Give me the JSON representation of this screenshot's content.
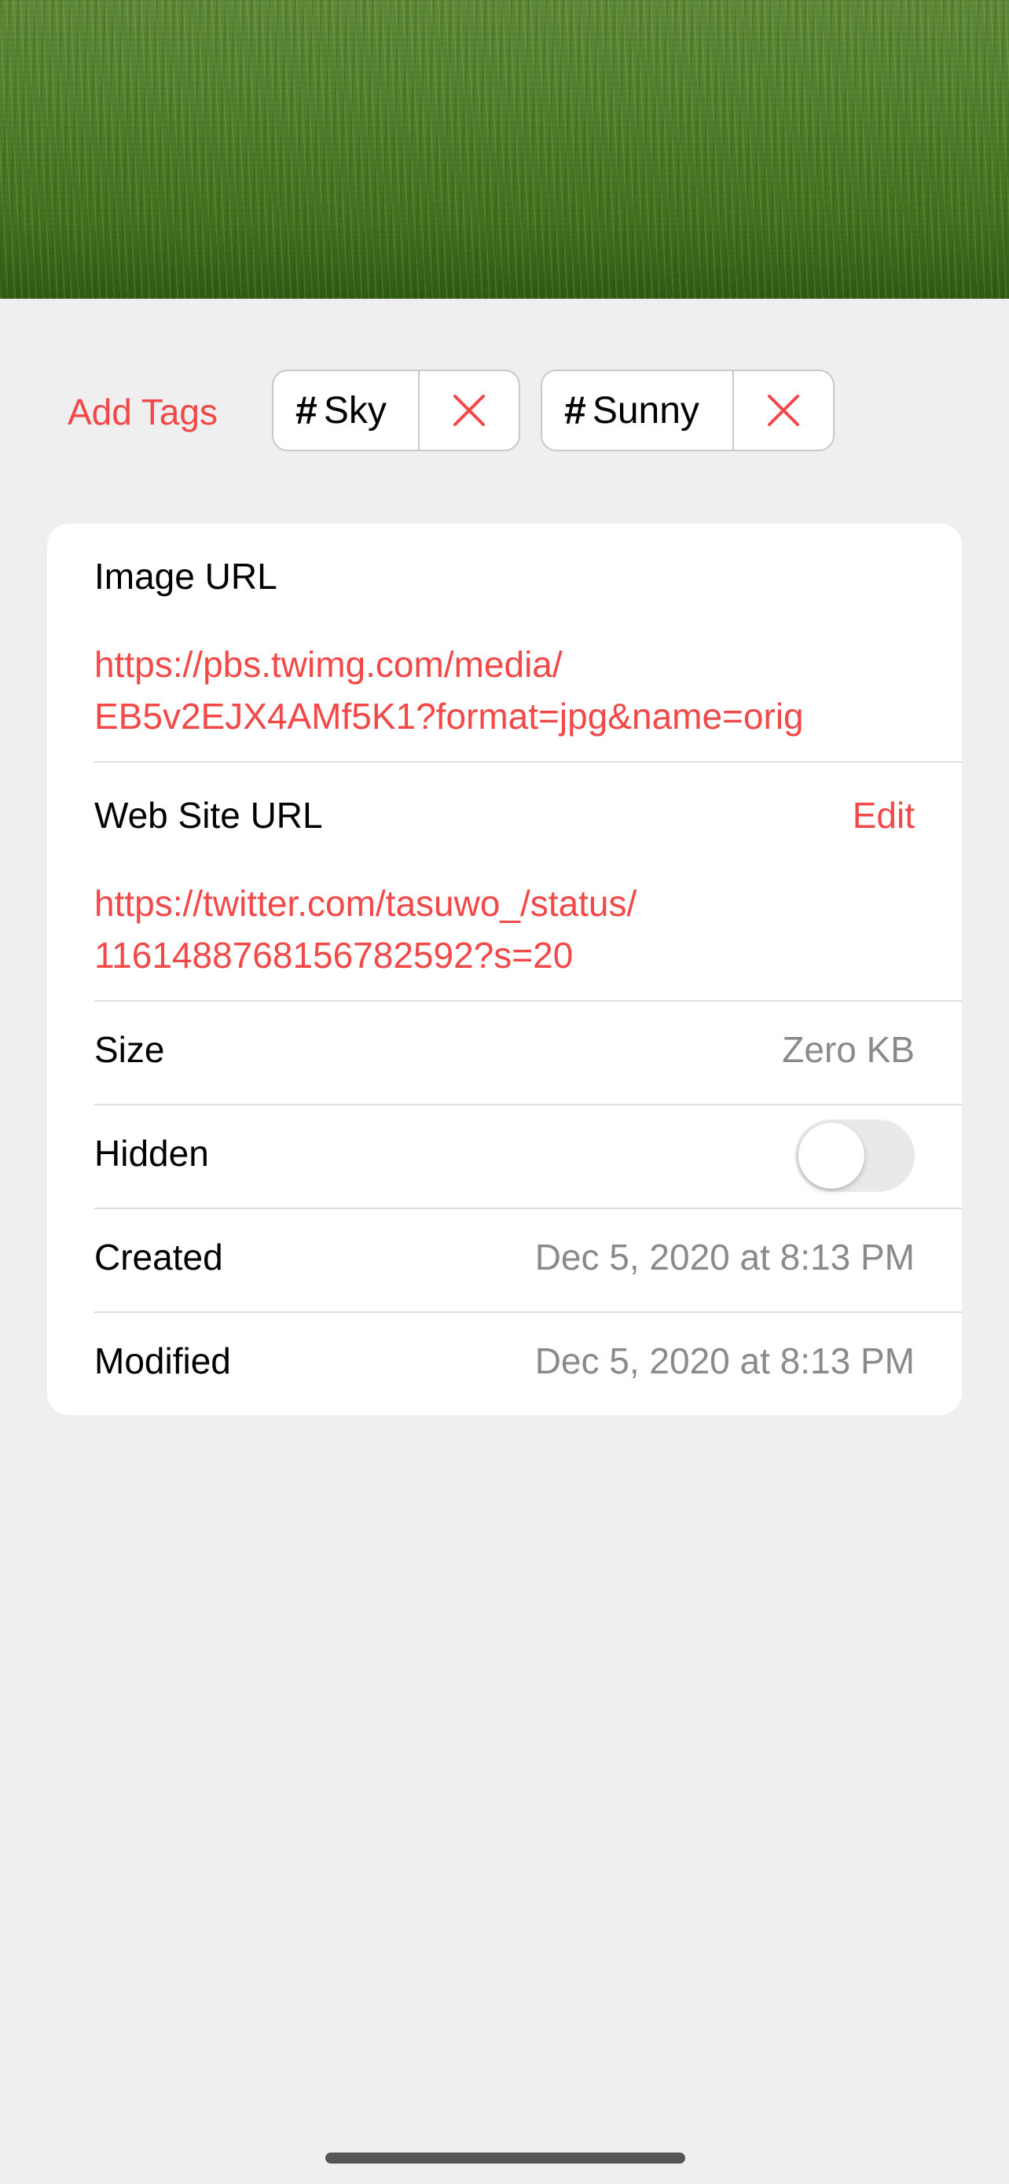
{
  "tags": {
    "add_label": "Add Tags",
    "items": [
      {
        "hash": "#",
        "name": "Sky"
      },
      {
        "hash": "#",
        "name": "Sunny"
      }
    ]
  },
  "details": {
    "image_url_label": "Image URL",
    "image_url_line1": "https://pbs.twimg.com/media/",
    "image_url_line2": "EB5v2EJX4AMf5K1?format=jpg&name=orig",
    "website_url_label": "Web Site URL",
    "website_edit_label": "Edit",
    "website_url_line1": "https://twitter.com/tasuwo_/status/",
    "website_url_line2": "1161488768156782592?s=20",
    "size_label": "Size",
    "size_value": "Zero KB",
    "hidden_label": "Hidden",
    "hidden_on": false,
    "created_label": "Created",
    "created_value": "Dec 5, 2020 at 8:13 PM",
    "modified_label": "Modified",
    "modified_value": "Dec 5, 2020 at 8:13 PM"
  },
  "colors": {
    "accent": "#f24848",
    "background": "#efefef",
    "card": "#ffffff",
    "secondary_text": "#8a8a8e"
  }
}
